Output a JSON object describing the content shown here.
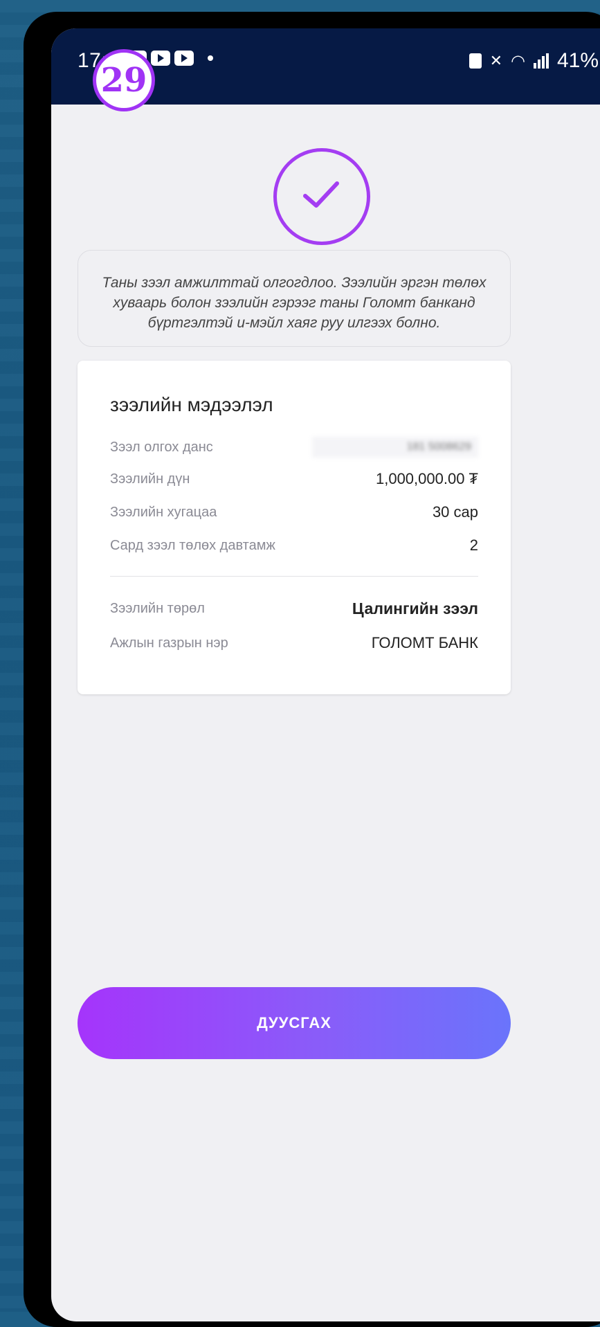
{
  "status_bar": {
    "time": "17:46",
    "battery": "41%"
  },
  "step_badge": "29",
  "notice": "Таны зээл амжилттай олгогдлоо. Зээлийн эргэн төлөх хуваарь болон зээлийн гэрээг таны Голомт банканд бүртгэлтэй и-мэйл хаяг руу илгээх болно.",
  "loan_info": {
    "title": "зээлийн мэдээлэл",
    "rows": [
      {
        "label": "Зээл олгох данс",
        "value": "181 5008629"
      },
      {
        "label": "Зээлийн дүн",
        "value": "1,000,000.00 ₮"
      },
      {
        "label": "Зээлийн хугацаа",
        "value": "30 сар"
      },
      {
        "label": "Сард зээл төлөх давтамж",
        "value": "2"
      },
      {
        "label": "Зээлийн төрөл",
        "value": "Цалингийн зээл"
      },
      {
        "label": "Ажлын газрын нэр",
        "value": "ГОЛОМТ БАНК"
      }
    ]
  },
  "finish_button": "ДУУСГАХ",
  "colors": {
    "accent": "#a43df2",
    "status_bar": "#061a45",
    "button_gradient_start": "#a534fb",
    "button_gradient_end": "#6a74fb"
  },
  "icons": [
    "check-icon",
    "youtube-icon",
    "wifi-icon",
    "signal-icon",
    "battery-icon",
    "mute-icon"
  ]
}
